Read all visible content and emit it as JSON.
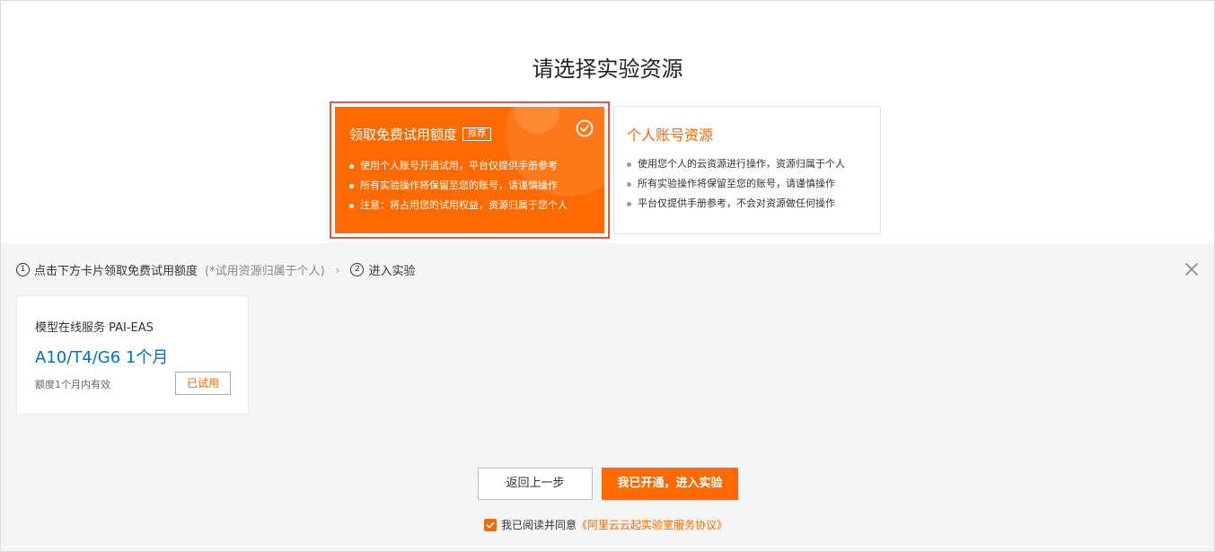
{
  "title": "请选择实验资源",
  "free_card": {
    "title": "领取免费试用额度",
    "badge": "推荐",
    "items": [
      "使用个人账号开通试用，平台仅提供手册参考",
      "所有实验操作将保留至您的账号，请谨慎操作",
      "注意：将占用您的试用权益，资源归属于您个人"
    ]
  },
  "personal_card": {
    "title": "个人账号资源",
    "items": [
      "使用您个人的云资源进行操作，资源归属于个人",
      "所有实验操作将保留至您的账号，请谨慎操作",
      "平台仅提供手册参考，不会对资源做任何操作"
    ]
  },
  "steps": {
    "step1_num": "1",
    "step1_label": "点击下方卡片领取免费试用额度",
    "step1_note": "(*试用资源归属于个人)",
    "separator": "›",
    "step2_num": "2",
    "step2_label": "进入实验"
  },
  "resource": {
    "service": "模型在线服务 PAI-EAS",
    "spec": "A10/T4/G6 1个月",
    "validity": "额度1个月内有效",
    "button": "已试用"
  },
  "buttons": {
    "back": "返回上一步",
    "enter": "我已开通，进入实验"
  },
  "agreement": {
    "text": "我已阅读并同意",
    "link": "《阿里云云起实验室服务协议》",
    "checked": true
  },
  "colors": {
    "accent": "#ff6a00",
    "selected_border": "#e4564a",
    "link_blue": "#0070cc"
  }
}
